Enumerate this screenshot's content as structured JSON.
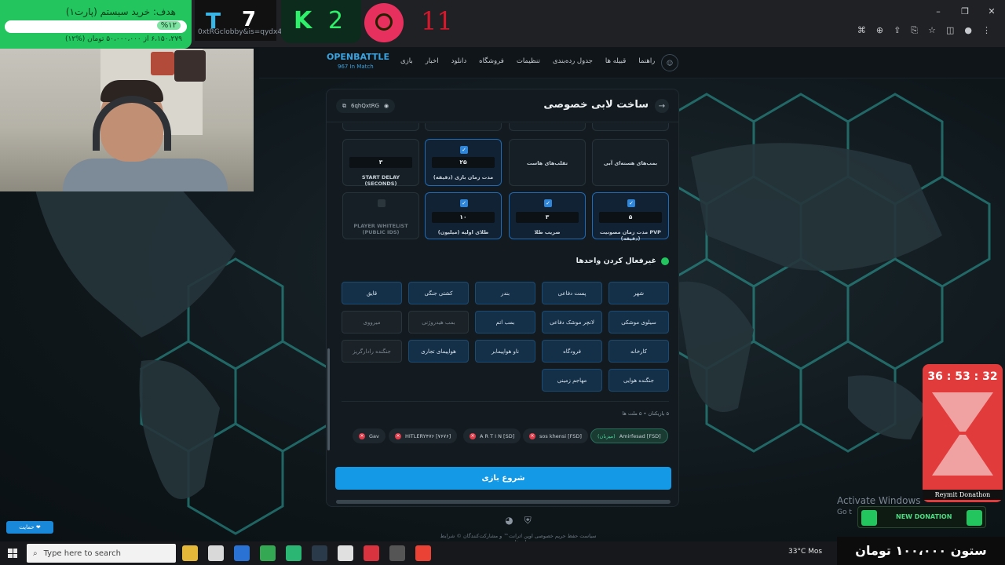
{
  "browser": {
    "window_controls": [
      "–",
      "❐",
      "✕"
    ],
    "omnibox_icons": [
      "translate-icon",
      "zoom-icon",
      "share-icon",
      "install-icon",
      "star-icon",
      "extensions-icon",
      "profile-icon",
      "menu-icon"
    ]
  },
  "overlay": {
    "goal_title": "هدف: خرید سیستم (پارت۱)",
    "goal_percent": "%۱۲",
    "goal_progress": 0.12,
    "goal_sub": "۶،۱۵۰،۲۷۹ از ۵۰،۰۰۰،۰۰۰ تومان (%۱۲)",
    "score_t_logo": "T",
    "score_t": "7",
    "lobby_url": "0xtRGclobby&is=qydx4",
    "score_k_logo": "K",
    "score_k": "2",
    "score_r": "11"
  },
  "header": {
    "brand": "OPENBATTLE",
    "brand_sub": "967 In Match",
    "nav": [
      "بازی",
      "اخبار",
      "دانلود",
      "فروشگاه",
      "تنظیمات",
      "جدول رده‌بندی",
      "قبیله ها",
      "راهنما"
    ]
  },
  "panel": {
    "title": "ساخت لابی خصوصی",
    "back": "→",
    "lobby_code": "6qhQxtRG",
    "settings_row1": [
      {
        "label": "بمب‌های هسته‌ای آبی",
        "value": null,
        "checked": false
      },
      {
        "label": "تقلب‌های هاست",
        "value": null,
        "checked": false
      },
      {
        "label": "مدت زمان بازی (دقیقه)",
        "value": "۲۵",
        "checked": true
      },
      {
        "label": "START DELAY (SECONDS)",
        "value": "۳",
        "checked": false
      }
    ],
    "settings_row2": [
      {
        "label": "مدت زمان مصونیت PVP (دقیقه)",
        "value": "۵",
        "checked": true
      },
      {
        "label": "ضریب طلا",
        "value": "۳",
        "checked": true
      },
      {
        "label": "طلای اولیه (میلیون)",
        "value": "۱۰",
        "checked": true
      },
      {
        "label": "PLAYER WHITELIST (PUBLIC IDS)",
        "value": null,
        "checked": false
      }
    ],
    "units_title": "غیرفعال کردن واحدها",
    "units": [
      {
        "label": "شهر",
        "off": false
      },
      {
        "label": "پست دفاعی",
        "off": false
      },
      {
        "label": "بندر",
        "off": false
      },
      {
        "label": "کشتی جنگی",
        "off": false
      },
      {
        "label": "قایق",
        "off": false
      },
      {
        "label": "سیلوی موشکی",
        "off": false
      },
      {
        "label": "لانچر موشک دفاعی",
        "off": false
      },
      {
        "label": "بمب اتم",
        "off": false
      },
      {
        "label": "بمب هیدروژنی",
        "off": true
      },
      {
        "label": "میرووی",
        "off": true
      },
      {
        "label": "کارخانه",
        "off": false
      },
      {
        "label": "فرودگاه",
        "off": false
      },
      {
        "label": "ناو هواپیمابر",
        "off": false
      },
      {
        "label": "هواپیمای تجاری",
        "off": false
      },
      {
        "label": "جنگنده رادارگریز",
        "off": true
      },
      {
        "label": "جنگنده هوایی",
        "off": false
      },
      {
        "label": "مهاجم زمینی",
        "off": false
      }
    ],
    "players_meta": "۵ بازیکنان  •  ۵ ملت ها",
    "players": [
      {
        "name": "Amirfesad [FSD]",
        "tag": "(میزبان)",
        "host": true
      },
      {
        "name": "sos khensi [FSD]",
        "tag": "",
        "host": false
      },
      {
        "name": "A R T I N [SD]",
        "tag": "",
        "host": false
      },
      {
        "name": "HITLERY۴۷۶ [۷۶۷۶]",
        "tag": "",
        "host": false
      },
      {
        "name": "Gav",
        "tag": "",
        "host": false
      }
    ],
    "start_label": "شروع بازی"
  },
  "footer": {
    "links": "سیاست حفظ حریم خصوصی   اوپن اترانت™ و مشارکت‌کنندگان ©   شرایط استفاده",
    "support": "حمایت ❤"
  },
  "timer": {
    "time": "36 : 53 : 32",
    "label": "Reymit Donathon"
  },
  "windows": {
    "activate": "Activate Windows",
    "activate_sub": "Go t",
    "donation": "NEW DONATION",
    "column": "ستون ۱۰۰،۰۰۰ تومان"
  },
  "taskbar": {
    "search_placeholder": "Type here to search",
    "weather": "33°C  Mos"
  }
}
